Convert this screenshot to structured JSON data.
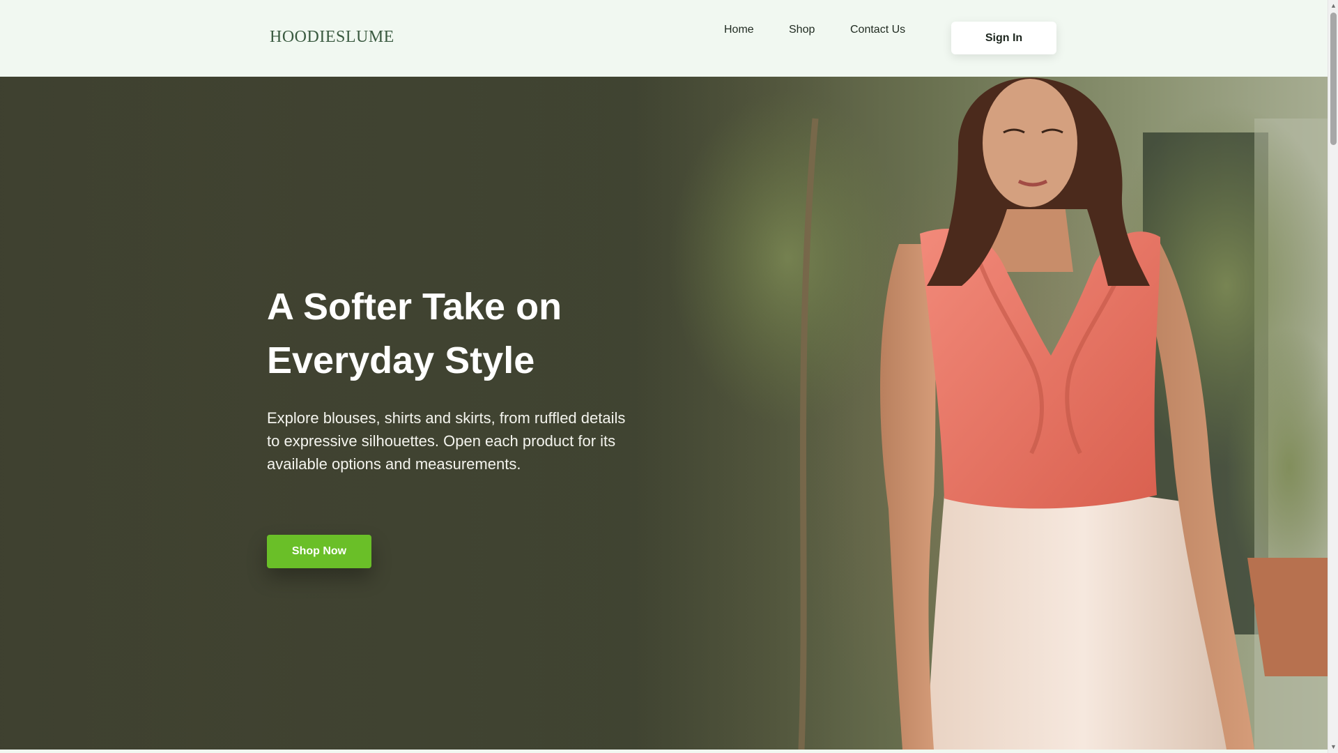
{
  "header": {
    "logo": "HOODIESLUME",
    "nav": [
      {
        "label": "Home"
      },
      {
        "label": "Shop"
      },
      {
        "label": "Contact Us"
      }
    ],
    "sign_in_label": "Sign In"
  },
  "hero": {
    "title_line1": "A Softer Take on",
    "title_line2": "Everyday Style",
    "description": "Explore blouses, shirts and skirts, from ruffled details to expressive silhouettes. Open each product for its available options and measurements.",
    "cta_label": "Shop Now"
  },
  "colors": {
    "header_bg": "#f1f8f1",
    "logo": "#3a5a40",
    "cta": "#6abf28",
    "blouse": "#e9766a",
    "skirt": "#f1e0d3"
  },
  "icons": {
    "scroll_up": "triangle-up-icon",
    "scroll_down": "triangle-down-icon"
  }
}
